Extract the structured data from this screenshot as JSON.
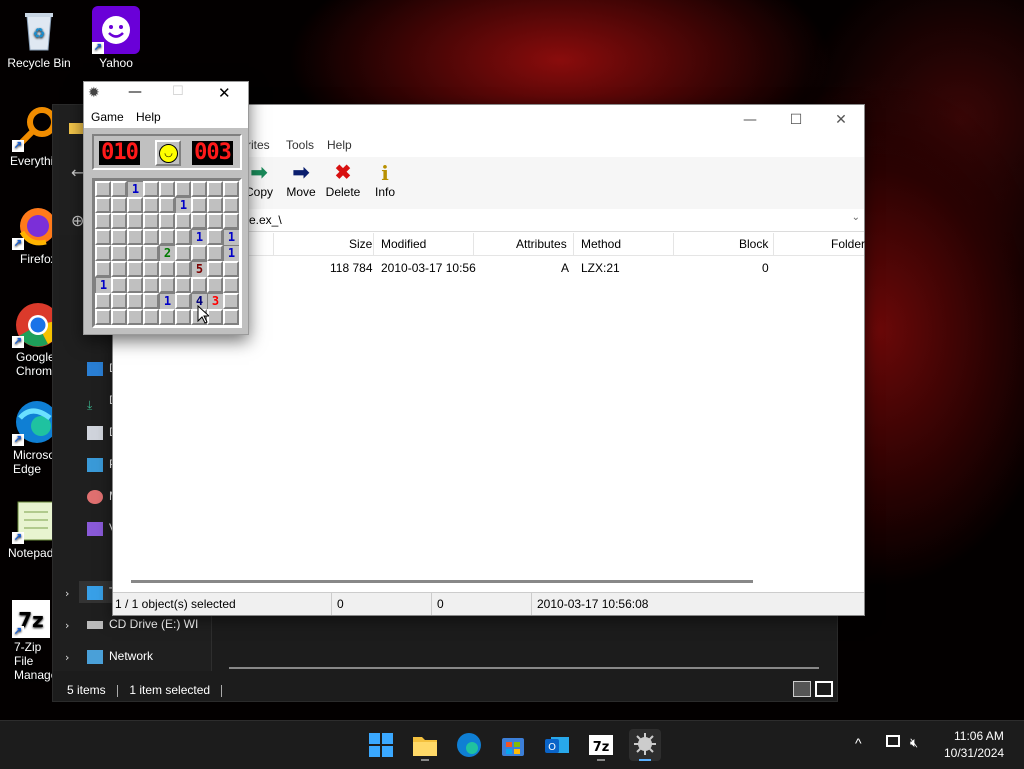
{
  "desktop": {
    "icons": [
      {
        "label": "Recycle Bin"
      },
      {
        "label": "Yahoo Messenger"
      },
      {
        "label": "Everything"
      },
      {
        "label": "Firefox"
      },
      {
        "label": "Google Chrome"
      },
      {
        "label": "Microsoft Edge"
      },
      {
        "label": "Notepad"
      },
      {
        "label": "7-Zip File Manager"
      }
    ]
  },
  "explorer": {
    "nav": {
      "items": [
        "D",
        "D",
        "D",
        "P",
        "M",
        "V"
      ],
      "this_pc": "T",
      "cd_drive": "CD Drive (E:) WI",
      "network": "Network"
    },
    "status": {
      "items": "5 items",
      "selected": "1 item selected"
    }
  },
  "zip": {
    "menu": {
      "favorites": "rites",
      "tools": "Tools",
      "help": "Help"
    },
    "toolbar": {
      "copy": "Copy",
      "move": "Move",
      "delete": "Delete",
      "info": "Info"
    },
    "address": "e.ex_\\",
    "columns": [
      "Size",
      "Modified",
      "Attributes",
      "Method",
      "Block",
      "Folder"
    ],
    "rows": [
      {
        "size": "118 784",
        "modified": "2010-03-17 10:56",
        "attributes": "A",
        "method": "LZX:21",
        "block": "0"
      }
    ],
    "status": {
      "selected": "1 / 1 object(s) selected",
      "size": "0",
      "packed": "0",
      "modified": "2010-03-17 10:56:08"
    }
  },
  "minesweeper": {
    "menu": {
      "game": "Game",
      "help": "Help"
    },
    "mines_counter": "010",
    "timer": "003",
    "grid_numbers": [
      {
        "r": 0,
        "c": 2,
        "n": "1",
        "color": "#0000c8"
      },
      {
        "r": 1,
        "c": 5,
        "n": "1",
        "color": "#0000c8"
      },
      {
        "r": 3,
        "c": 6,
        "n": "1",
        "color": "#0000c8"
      },
      {
        "r": 3,
        "c": 8,
        "n": "1",
        "color": "#0000c8"
      },
      {
        "r": 4,
        "c": 4,
        "n": "2",
        "color": "#007b00"
      },
      {
        "r": 4,
        "c": 8,
        "n": "1",
        "color": "#0000c8"
      },
      {
        "r": 5,
        "c": 6,
        "n": "5",
        "color": "#7b0000"
      },
      {
        "r": 6,
        "c": 0,
        "n": "1",
        "color": "#0000c8"
      },
      {
        "r": 7,
        "c": 4,
        "n": "1",
        "color": "#0000c8"
      },
      {
        "r": 7,
        "c": 6,
        "n": "4",
        "color": "#00007b"
      },
      {
        "r": 7,
        "c": 7,
        "n": "3",
        "color": "#ff0000"
      }
    ]
  },
  "taskbar": {
    "time": "11:06 AM",
    "date": "10/31/2024"
  }
}
